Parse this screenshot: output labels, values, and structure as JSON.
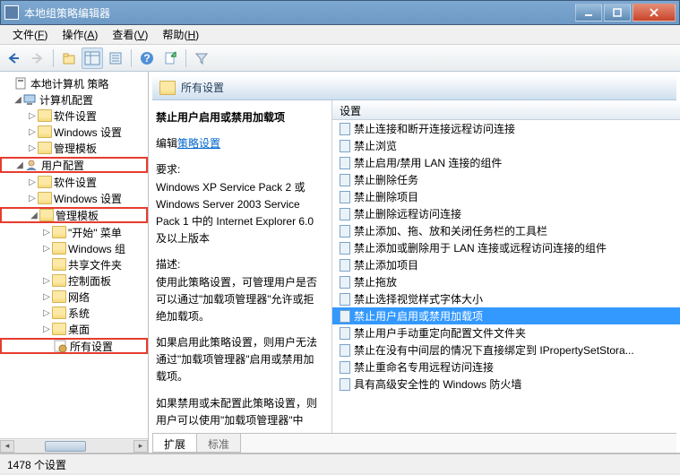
{
  "window": {
    "title": "本地组策略编辑器"
  },
  "menus": [
    {
      "label": "文件",
      "key": "F"
    },
    {
      "label": "操作",
      "key": "A"
    },
    {
      "label": "查看",
      "key": "V"
    },
    {
      "label": "帮助",
      "key": "H"
    }
  ],
  "tree": {
    "root": "本地计算机 策略",
    "computer": {
      "label": "计算机配置",
      "children": [
        "软件设置",
        "Windows 设置",
        "管理模板"
      ]
    },
    "user": {
      "label": "用户配置",
      "software": "软件设置",
      "windows": "Windows 设置",
      "admin": {
        "label": "管理模板",
        "children": [
          "\"开始\" 菜单",
          "Windows 组",
          "共享文件夹",
          "控制面板",
          "网络",
          "系统",
          "桌面"
        ],
        "all_settings": "所有设置"
      }
    }
  },
  "right": {
    "header": "所有设置",
    "detail": {
      "title": "禁止用户启用或禁用加载项",
      "edit_prefix": "编辑",
      "edit_link": "策略设置",
      "req_label": "要求:",
      "req_text": "Windows XP Service Pack 2 或 Windows Server 2003 Service Pack 1 中的 Internet Explorer 6.0 及以上版本",
      "desc_label": "描述:",
      "desc_p1": "使用此策略设置，可管理用户是否可以通过\"加载项管理器\"允许或拒绝加载项。",
      "desc_p2": "如果启用此策略设置，则用户无法通过\"加载项管理器\"启用或禁用加载项。",
      "desc_p3": "如果禁用或未配置此策略设置，则用户可以使用\"加载项管理器\"中"
    },
    "list_header": "设置",
    "settings": [
      "禁止连接和断开连接远程访问连接",
      "禁止浏览",
      "禁止启用/禁用 LAN 连接的组件",
      "禁止删除任务",
      "禁止删除项目",
      "禁止删除远程访问连接",
      "禁止添加、拖、放和关闭任务栏的工具栏",
      "禁止添加或删除用于 LAN 连接或远程访问连接的组件",
      "禁止添加项目",
      "禁止拖放",
      "禁止选择视觉样式字体大小",
      "禁止用户启用或禁用加载项",
      "禁止用户手动重定向配置文件文件夹",
      "禁止在没有中间层的情况下直接绑定到 IPropertySetStora...",
      "禁止重命名专用远程访问连接",
      "具有高级安全性的 Windows 防火墙"
    ],
    "selected_index": 11,
    "tabs": {
      "ext": "扩展",
      "std": "标准"
    }
  },
  "status": "1478 个设置"
}
